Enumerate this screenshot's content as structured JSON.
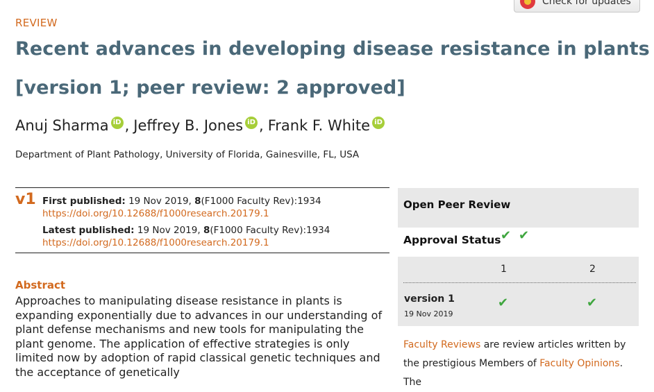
{
  "updates_button": {
    "label": "Check for updates",
    "icon": "crossmark-icon"
  },
  "article_type": "REVIEW",
  "title": {
    "line1": "Recent advances in developing disease resistance in plants",
    "line2": "[version 1; peer review: 2 approved]"
  },
  "authors": [
    {
      "name": "Anuj Sharma",
      "sep": ","
    },
    {
      "name": "Jeffrey B. Jones",
      "sep": ","
    },
    {
      "name": "Frank F. White",
      "sep": ""
    }
  ],
  "affiliation": "Department of Plant Pathology, University of Florida, Gainesville, FL, USA",
  "version_tag": "v1",
  "first_published": {
    "label": "First published:",
    "date": "19 Nov 2019,",
    "volume": "8",
    "citation": "(F1000 Faculty Rev):1934",
    "doi": "https://doi.org/10.12688/f1000research.20179.1"
  },
  "latest_published": {
    "label": "Latest published:",
    "date": "19 Nov 2019,",
    "volume": "8",
    "citation": "(F1000 Faculty Rev):1934",
    "doi": "https://doi.org/10.12688/f1000research.20179.1"
  },
  "abstract": {
    "heading": "Abstract",
    "body": "Approaches to manipulating disease resistance in plants is expanding exponentially due to advances in our understanding of plant defense mechanisms and new tools for manipulating the plant genome. The application of effective strategies is only limited now by adoption of rapid classical genetic techniques and the acceptance of genetically"
  },
  "peer_review": {
    "heading": "Open Peer Review",
    "approval_label": "Approval Status",
    "approval_checks": [
      "✔",
      "✔"
    ],
    "columns": [
      "1",
      "2"
    ],
    "version_label": "version 1",
    "version_date": "19 Nov 2019",
    "version_checks": [
      "✔",
      "✔"
    ],
    "status_color": "#3fa63f"
  },
  "faculty": {
    "link1": "Faculty Reviews",
    "text1": " are review articles written by the prestigious Members of ",
    "link2": "Faculty Opinions",
    "text2": ". The"
  },
  "colors": {
    "accent": "#d2691e",
    "title": "#4a6878",
    "panel_bg": "#e8e8e8"
  }
}
